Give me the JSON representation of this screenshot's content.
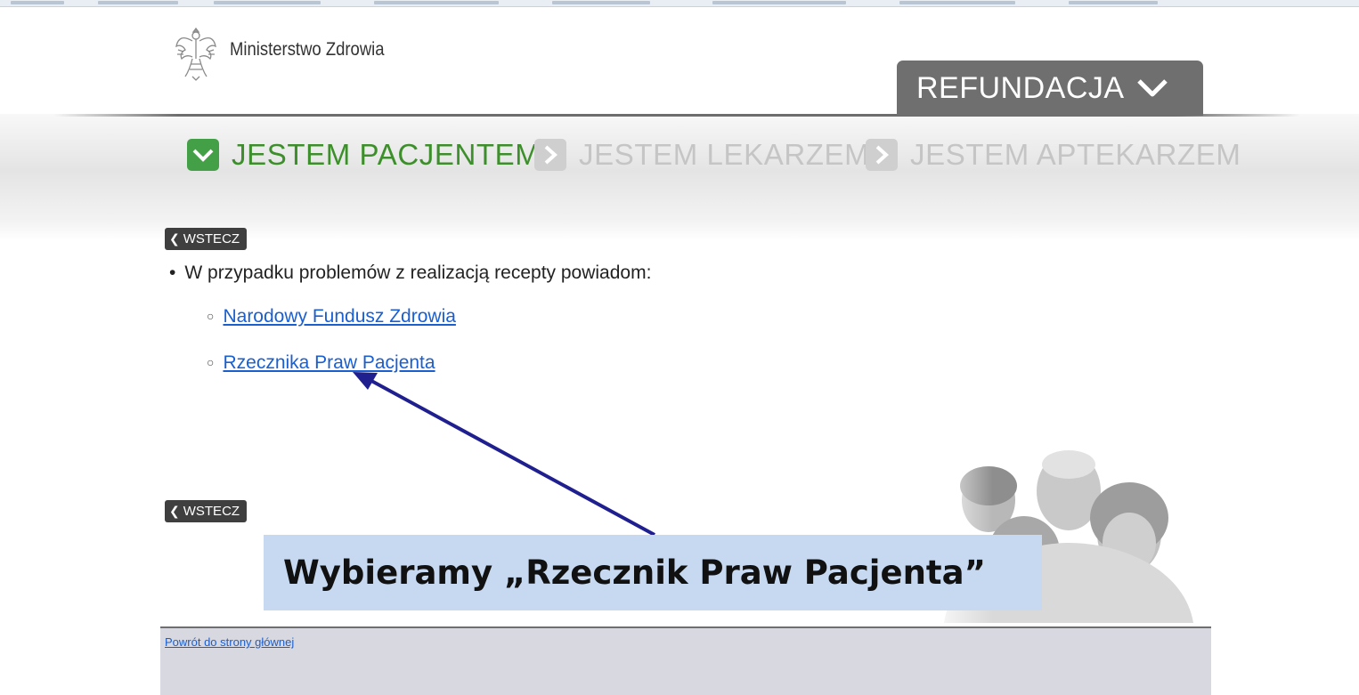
{
  "header": {
    "logo_text": "Ministerstwo Zdrowia",
    "section_tab": "REFUNDACJA"
  },
  "nav": {
    "items": [
      {
        "label": "JESTEM PACJENTEM",
        "active": true
      },
      {
        "label": "JESTEM LEKARZEM",
        "active": false
      },
      {
        "label": "JESTEM APTEKARZEM",
        "active": false
      }
    ]
  },
  "back_label": "WSTECZ",
  "content": {
    "intro": "W przypadku problemów z realizacją recepty powiadom:",
    "links": [
      {
        "label": "Narodowy Fundusz Zdrowia"
      },
      {
        "label": "Rzecznika Praw Pacjenta"
      }
    ]
  },
  "callout": {
    "text": "Wybieramy „Rzecznik Praw Pacjenta”"
  },
  "footer": {
    "home_link": "Powrót do strony głównej"
  },
  "colors": {
    "active_green": "#43a047",
    "link_blue": "#1a5fd0",
    "arrow_navy": "#1f1f8f",
    "callout_bg": "#c6d9f1"
  },
  "icons": [
    "polish-eagle-icon",
    "chevron-down-icon",
    "checkbox-check-icon",
    "chevron-right-icon",
    "back-arrow-icon"
  ]
}
